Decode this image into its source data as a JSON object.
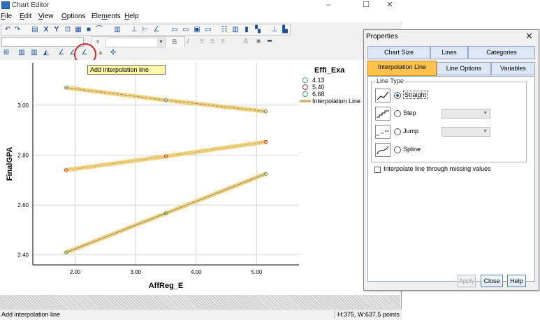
{
  "window": {
    "title": "Chart Editor",
    "minimize": "–",
    "maximize": "☐",
    "close": "✕"
  },
  "menu": [
    {
      "label": "File",
      "ul": "F",
      "rest": "ile"
    },
    {
      "label": "Edit",
      "ul": "E",
      "rest": "dit"
    },
    {
      "label": "View",
      "ul": "V",
      "rest": "iew"
    },
    {
      "label": "Options",
      "ul": "O",
      "rest": "ptions"
    },
    {
      "label": "Elements",
      "pre": "Ele",
      "ul": "m",
      "rest": "ents"
    },
    {
      "label": "Help",
      "ul": "H",
      "rest": "elp"
    }
  ],
  "format_toolbar": {
    "bold": "B",
    "italic": "I",
    "text_a": "A"
  },
  "tooltip": "Add interpolation line",
  "status": {
    "left": "Add interpolation line",
    "right": "H:375, W:637.5 points"
  },
  "colors": {
    "accent_tab": "#ffc24d",
    "highlight_circle": "#d7262b",
    "interp_line": "#f3d27c",
    "marker_4_13": "#4a90d9",
    "marker_5_40": "#d6243a",
    "marker_6_68": "#3b9d5c"
  },
  "chart_data": {
    "type": "line",
    "xlabel": "AffReg_E",
    "ylabel": "FinalGPA",
    "x_ticks": [
      "2.00",
      "3.00",
      "4.00",
      "5.00"
    ],
    "y_ticks": [
      "2.40",
      "2.60",
      "2.80",
      "3.00"
    ],
    "xlim": [
      1.3,
      5.7
    ],
    "ylim": [
      2.36,
      3.17
    ],
    "grid": true,
    "legend": {
      "title": "Effi_Exa",
      "placement": "top-right",
      "interp_label": "Interpolation Line"
    },
    "x": [
      1.85,
      3.5,
      5.15
    ],
    "series": [
      {
        "name": "4.13",
        "values": [
          3.07,
          3.02,
          2.975
        ],
        "marker": "circle",
        "color": "#4a90d9"
      },
      {
        "name": "5.40",
        "values": [
          2.74,
          2.795,
          2.853
        ],
        "marker": "circle",
        "color": "#d6243a"
      },
      {
        "name": "6.68",
        "values": [
          2.41,
          2.567,
          2.725
        ],
        "marker": "circle",
        "color": "#3b9d5c"
      }
    ]
  },
  "properties": {
    "title": "Properties",
    "close": "✕",
    "tabs_row1": [
      "Chart Size",
      "Lines",
      "Categories"
    ],
    "tabs_row2": [
      "Interpolation Line",
      "Line Options",
      "Variables"
    ],
    "line_type_label": "Line Type",
    "options": [
      {
        "label": "Straight",
        "selected": true
      },
      {
        "label": "Step",
        "selected": false
      },
      {
        "label": "Jump",
        "selected": false
      },
      {
        "label": "Spline",
        "selected": false
      }
    ],
    "checkbox_label": "Interpolate line through missing values",
    "buttons": {
      "apply": "Apply",
      "close": "Close",
      "help": "Help"
    }
  }
}
